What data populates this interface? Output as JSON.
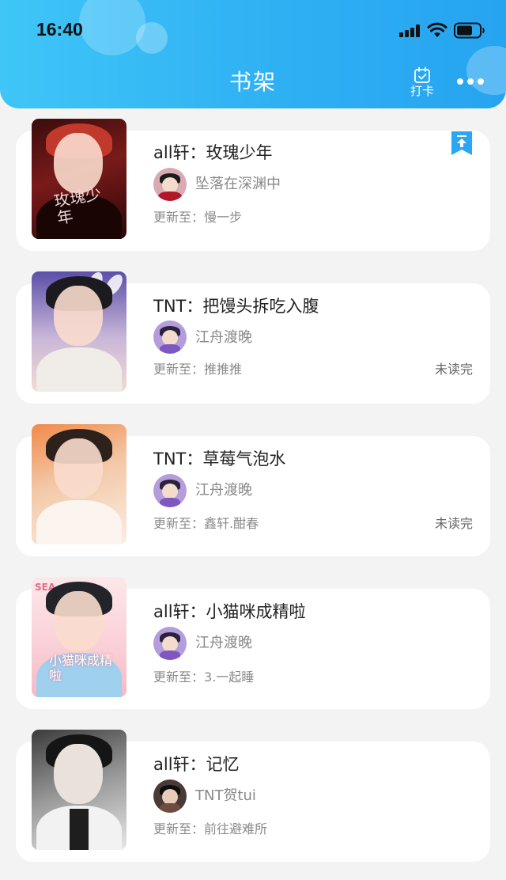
{
  "status_bar": {
    "time": "16:40"
  },
  "header": {
    "title": "书架",
    "checkin_label": "打卡"
  },
  "labels": {
    "update_prefix": "更新至："
  },
  "books": [
    {
      "title": "all轩：玫瑰少年",
      "author": "坠落在深渊中",
      "latest": "慢一步",
      "status": "",
      "cover_text": "玫瑰少年",
      "pinned": true
    },
    {
      "title": "TNT：把馒头拆吃入腹",
      "author": "江舟渡晚",
      "latest": "推推推",
      "status": "未读完",
      "cover_text": "",
      "pinned": false
    },
    {
      "title": "TNT：草莓气泡水",
      "author": "江舟渡晚",
      "latest": "鑫轩.酣春",
      "status": "未读完",
      "cover_text": "",
      "pinned": false
    },
    {
      "title": "all轩：小猫咪成精啦",
      "author": "江舟渡晚",
      "latest": "3.一起睡",
      "status": "",
      "cover_text": "小猫咪成精啦",
      "pinned": false
    },
    {
      "title": "all轩：记忆",
      "author": "TNT贺tui",
      "latest": "前往避难所",
      "status": "",
      "cover_text": "",
      "pinned": false
    }
  ],
  "colors": {
    "header_start": "#3fc6f7",
    "header_end": "#26a4f0",
    "pin_badge": "#2aa7f2",
    "background": "#f3f3f3"
  },
  "icons": [
    "signal-icon",
    "wifi-icon",
    "battery-icon",
    "calendar-check-icon",
    "more-dots-icon",
    "pin-top-icon"
  ]
}
